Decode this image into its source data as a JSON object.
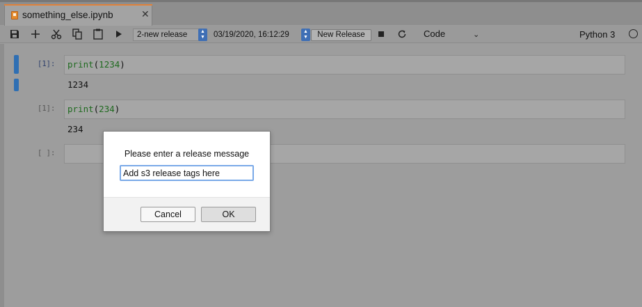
{
  "tab": {
    "title": "something_else.ipynb",
    "close_glyph": "✕",
    "icon": "notebook-icon"
  },
  "toolbar": {
    "release_select": "2-new release",
    "date_select": "03/19/2020, 16:12:29",
    "new_release_button": "New Release",
    "cell_type": "Code",
    "kernel_name": "Python 3",
    "icons": [
      "save-icon",
      "add-icon",
      "cut-icon",
      "copy-icon",
      "paste-icon",
      "run-icon",
      "stop-icon",
      "restart-icon"
    ]
  },
  "cells": [
    {
      "prompt": "[1]:",
      "fn": "print",
      "arg": "1234",
      "output": "1234"
    },
    {
      "prompt": "[1]:",
      "fn": "print",
      "arg": "234",
      "output": "234"
    },
    {
      "prompt": "[ ]:"
    }
  ],
  "dialog": {
    "message": "Please enter a release message",
    "input_value": "Add s3 release tags here",
    "cancel_label": "Cancel",
    "ok_label": "OK"
  },
  "colors": {
    "accent": "#2f6fb3",
    "tab_accent": "#e0823a",
    "input_focus": "#79a9e8"
  }
}
